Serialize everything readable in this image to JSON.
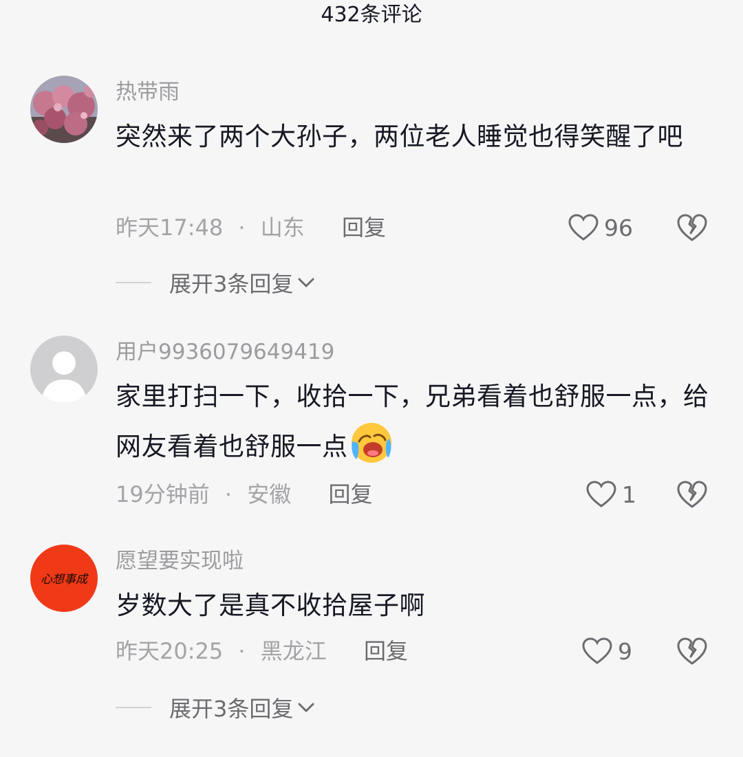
{
  "header": {
    "title": "432条评论"
  },
  "comments": [
    {
      "avatar": "flower-photo-avatar",
      "username": "热带雨",
      "text": "突然来了两个大孙子，两位老人睡觉也得笑醒了吧",
      "time": "昨天17:48",
      "separator": "·",
      "location": "山东",
      "reply_label": "回复",
      "likes": "96",
      "expand_label": "展开3条回复"
    },
    {
      "avatar": "default-user-avatar",
      "username": "用户9936079649419",
      "text": "家里打扫一下，收拾一下，兄弟看着也舒服一点，给网友看着也舒服一点",
      "emoji": "laughing-crying-emoji",
      "time": "19分钟前",
      "separator": "·",
      "location": "安徽",
      "reply_label": "回复",
      "likes": "1"
    },
    {
      "avatar": "red-calligraphy-avatar",
      "avatar_text": "心想事成",
      "username": "愿望要实现啦",
      "text": "岁数大了是真不收拾屋子啊",
      "time": "昨天20:25",
      "separator": "·",
      "location": "黑龙江",
      "reply_label": "回复",
      "likes": "9",
      "expand_label": "展开3条回复"
    }
  ],
  "colors": {
    "background": "#f6f6f6",
    "text": "#161823",
    "muted": "#a3a3a8",
    "avatar_red": "#f03a17"
  },
  "icons": {
    "like": "heart-outline-icon",
    "dislike": "broken-heart-icon",
    "expand": "chevron-down-icon"
  }
}
